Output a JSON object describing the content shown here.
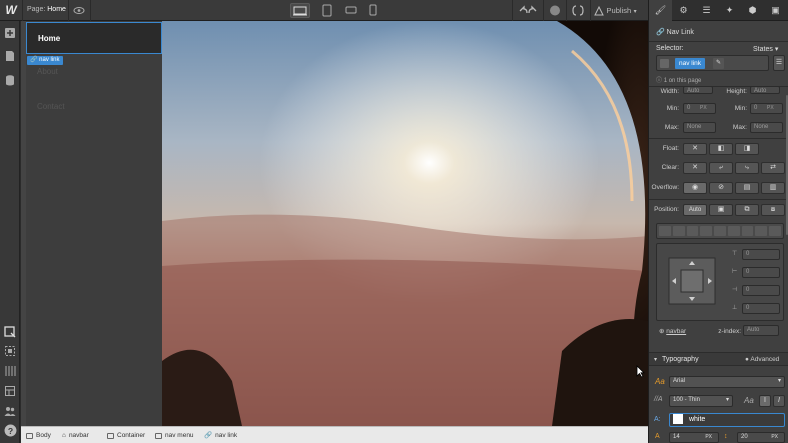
{
  "topbar": {
    "logo": "W",
    "page_label": "Page:",
    "page_name": "Home",
    "publish_label": "Publish"
  },
  "canvas": {
    "nav_items": [
      {
        "label": "Home"
      },
      {
        "label": "About"
      },
      {
        "label": "Contact"
      }
    ],
    "selected_tag": "nav link"
  },
  "breadcrumbs": [
    "Body",
    "navbar",
    "Container",
    "nav menu",
    "nav link"
  ],
  "panel": {
    "element_type": "Nav Link",
    "selector_label": "Selector:",
    "states_label": "States",
    "selector_chip": "nav link",
    "on_this_page": "1 on this page",
    "width_label": "Width:",
    "width_value": "Auto",
    "height_label": "Height:",
    "height_value": "Auto",
    "min_label": "Min:",
    "min_value": "0",
    "unit_px": "PX",
    "max_label": "Max:",
    "max_value": "None",
    "float_label": "Float:",
    "clear_label": "Clear:",
    "overflow_label": "Overflow:",
    "position_label": "Position:",
    "position_value": "Auto",
    "spacing_values": [
      "0",
      "0",
      "0",
      "0"
    ],
    "relative_to": "navbar",
    "zindex_label": "z-index:",
    "zindex_value": "Auto",
    "typography_label": "Typography",
    "advanced_label": "Advanced",
    "font_family": "Arial",
    "font_weight": "100 - Thin",
    "color_name": "white",
    "font_size": "14",
    "line_height": "20"
  }
}
